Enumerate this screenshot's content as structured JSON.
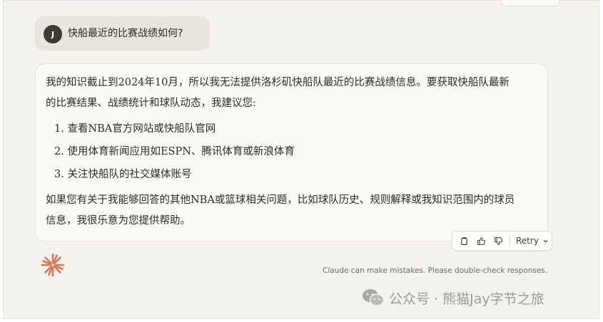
{
  "user_message": {
    "avatar_initial": "J",
    "text": "快船最近的比赛战绩如何?"
  },
  "assistant_reply": {
    "intro": "我的知识截止到2024年10月，所以我无法提供洛杉矶快船队最近的比赛战绩信息。要获取快船队最新的比赛结果、战绩统计和球队动态，我建议您:",
    "list": [
      "1. 查看NBA官方网站或快船队官网",
      "2. 使用体育新闻应用如ESPN、腾讯体育或新浪体育",
      "3. 关注快船队的社交媒体账号"
    ],
    "outro": "如果您有关于我能够回答的其他NBA或篮球相关问题，比如球队历史、规则解释或我知识范围内的球员信息，我很乐意为您提供帮助。"
  },
  "actions": {
    "retry_label": "Retry",
    "icons": [
      "copy-icon",
      "thumbs-up-icon",
      "thumbs-down-icon",
      "chevron-down-icon"
    ]
  },
  "disclaimer": "Claude can make mistakes. Please double-check responses.",
  "watermark": "公众号 · 熊猫Jay字节之旅",
  "colors": {
    "background": "#f4f2ec",
    "user_bubble": "#e8e5dc",
    "card": "#fbfaf7",
    "claude_accent": "#d97757"
  }
}
